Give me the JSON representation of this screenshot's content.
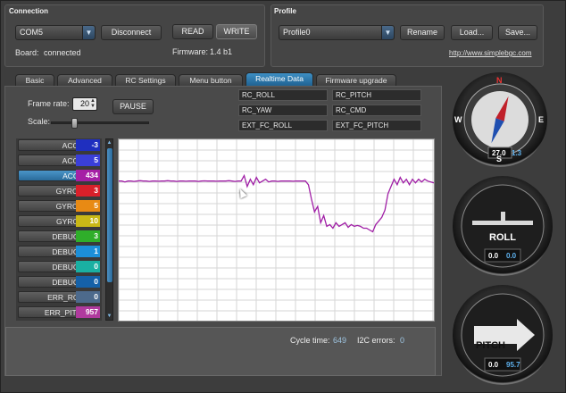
{
  "connection": {
    "title": "Connection",
    "port": "COM5",
    "disconnect_label": "Disconnect",
    "read_label": "READ",
    "write_label": "WRITE",
    "board_label": "Board:",
    "board_status": "connected",
    "firmware_label": "Firmware:",
    "firmware_version": "1.4 b1"
  },
  "profile": {
    "title": "Profile",
    "selected": "Profile0",
    "rename_label": "Rename",
    "load_label": "Load...",
    "save_label": "Save...",
    "website": "http://www.simplebgc.com"
  },
  "tabs": [
    "Basic",
    "Advanced",
    "RC Settings",
    "Menu button",
    "Realtime Data",
    "Firmware upgrade"
  ],
  "active_tab": "Realtime Data",
  "realtime": {
    "frame_rate_label": "Frame rate:",
    "frame_rate": "20",
    "scale_label": "Scale:",
    "scale_fraction": 0.2,
    "pause_label": "PAUSE",
    "rc_channels": [
      "RC_ROLL",
      "RC_PITCH",
      "RC_YAW",
      "RC_CMD",
      "EXT_FC_ROLL",
      "EXT_FC_PITCH"
    ]
  },
  "variables": [
    {
      "name": "ACC_X",
      "value": "-3",
      "color": "#1f2fbf"
    },
    {
      "name": "ACC_Y",
      "value": "5",
      "color": "#3a3fd8"
    },
    {
      "name": "ACC_Z",
      "value": "434",
      "color": "#a51fa5",
      "selected": true
    },
    {
      "name": "GYRO_X",
      "value": "3",
      "color": "#d8202a"
    },
    {
      "name": "GYRO_Y",
      "value": "5",
      "color": "#e88a14"
    },
    {
      "name": "GYRO_Z",
      "value": "10",
      "color": "#c9b816"
    },
    {
      "name": "DEBUG_1",
      "value": "3",
      "color": "#2fae2a"
    },
    {
      "name": "DEBUG_2",
      "value": "1",
      "color": "#1c8fd8"
    },
    {
      "name": "DEBUG_3",
      "value": "0",
      "color": "#1ab0a2"
    },
    {
      "name": "DEBUG_4",
      "value": "0",
      "color": "#1561a8"
    },
    {
      "name": "ERR_ROLL",
      "value": "0",
      "color": "#4d6a8c"
    },
    {
      "name": "ERR_PITCH",
      "value": "957",
      "color": "#b03a9e"
    }
  ],
  "status": {
    "cycle_time_label": "Cycle time:",
    "cycle_time": "649",
    "i2c_label": "I2C errors:",
    "i2c_errors": "0"
  },
  "compass": {
    "n": "N",
    "e": "E",
    "s": "S",
    "w": "W",
    "value_a": "27.0",
    "value_b": "1.3"
  },
  "roll_gauge": {
    "label": "ROLL",
    "value_a": "0.0",
    "value_b": "0.0"
  },
  "pitch_gauge": {
    "label": "PITCH",
    "value_a": "0.0",
    "value_b": "95.7"
  },
  "chart_data": {
    "type": "line",
    "series": [
      {
        "color": "#a01fa6",
        "y": [
          0.23,
          0.23,
          0.235,
          0.23,
          0.23,
          0.232,
          0.23,
          0.228,
          0.23,
          0.23,
          0.232,
          0.23,
          0.23,
          0.231,
          0.23,
          0.23,
          0.228,
          0.23,
          0.23,
          0.232,
          0.23,
          0.23,
          0.231,
          0.23,
          0.23,
          0.23,
          0.232,
          0.23,
          0.229,
          0.23,
          0.23,
          0.23,
          0.231,
          0.23,
          0.23,
          0.23,
          0.228,
          0.23,
          0.232,
          0.23,
          0.23,
          0.2,
          0.26,
          0.22,
          0.25,
          0.21,
          0.24,
          0.23,
          0.22,
          0.235,
          0.23,
          0.23,
          0.232,
          0.23,
          0.23,
          0.23,
          0.23,
          0.231,
          0.23,
          0.23,
          0.23,
          0.23,
          0.25,
          0.33,
          0.4,
          0.37,
          0.46,
          0.42,
          0.48,
          0.47,
          0.49,
          0.46,
          0.48,
          0.47,
          0.46,
          0.485,
          0.47,
          0.48,
          0.475,
          0.48,
          0.49,
          0.49,
          0.5,
          0.51,
          0.47,
          0.45,
          0.43,
          0.39,
          0.3,
          0.26,
          0.22,
          0.25,
          0.21,
          0.24,
          0.22,
          0.25,
          0.22,
          0.24,
          0.22,
          0.235,
          0.22,
          0.23,
          0.235,
          0.24
        ]
      }
    ]
  }
}
